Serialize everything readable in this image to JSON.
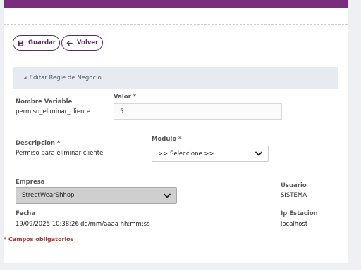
{
  "toolbar": {
    "guardar_label": "Guardar",
    "volver_label": "Volver",
    "guardar_icon": "save-icon",
    "volver_icon": "arrow-left-icon"
  },
  "section": {
    "title": "Editar Regle de Negocio"
  },
  "form": {
    "nombre_variable": {
      "label": "Nombre Variable",
      "value": "permiso_eliminar_cliente"
    },
    "valor": {
      "label": "Valor *",
      "value": "5"
    },
    "descripcion": {
      "label": "Descripcion *",
      "value": "Permiso para eliminar cliente"
    },
    "modulo": {
      "label": "Modulo *",
      "selected": ">> Seleccione >>"
    },
    "empresa": {
      "label": "Empresa",
      "selected": "StreetWearShhop"
    },
    "usuario": {
      "label": "Usuario",
      "value": "SISTEMA"
    },
    "fecha": {
      "label": "Fecha",
      "value": "19/09/2025 10:38:26",
      "format": "dd/mm/aaaa hh:mm:ss"
    },
    "ip_estacion": {
      "label": "Ip Estacion",
      "value": "localhost"
    }
  },
  "footer": {
    "required_note": "* Campos obligatorios"
  },
  "colors": {
    "accent": "#7b2d7d",
    "button_border": "#5b2a66",
    "required": "#b0332b",
    "section_bg": "#e6ebf2"
  }
}
